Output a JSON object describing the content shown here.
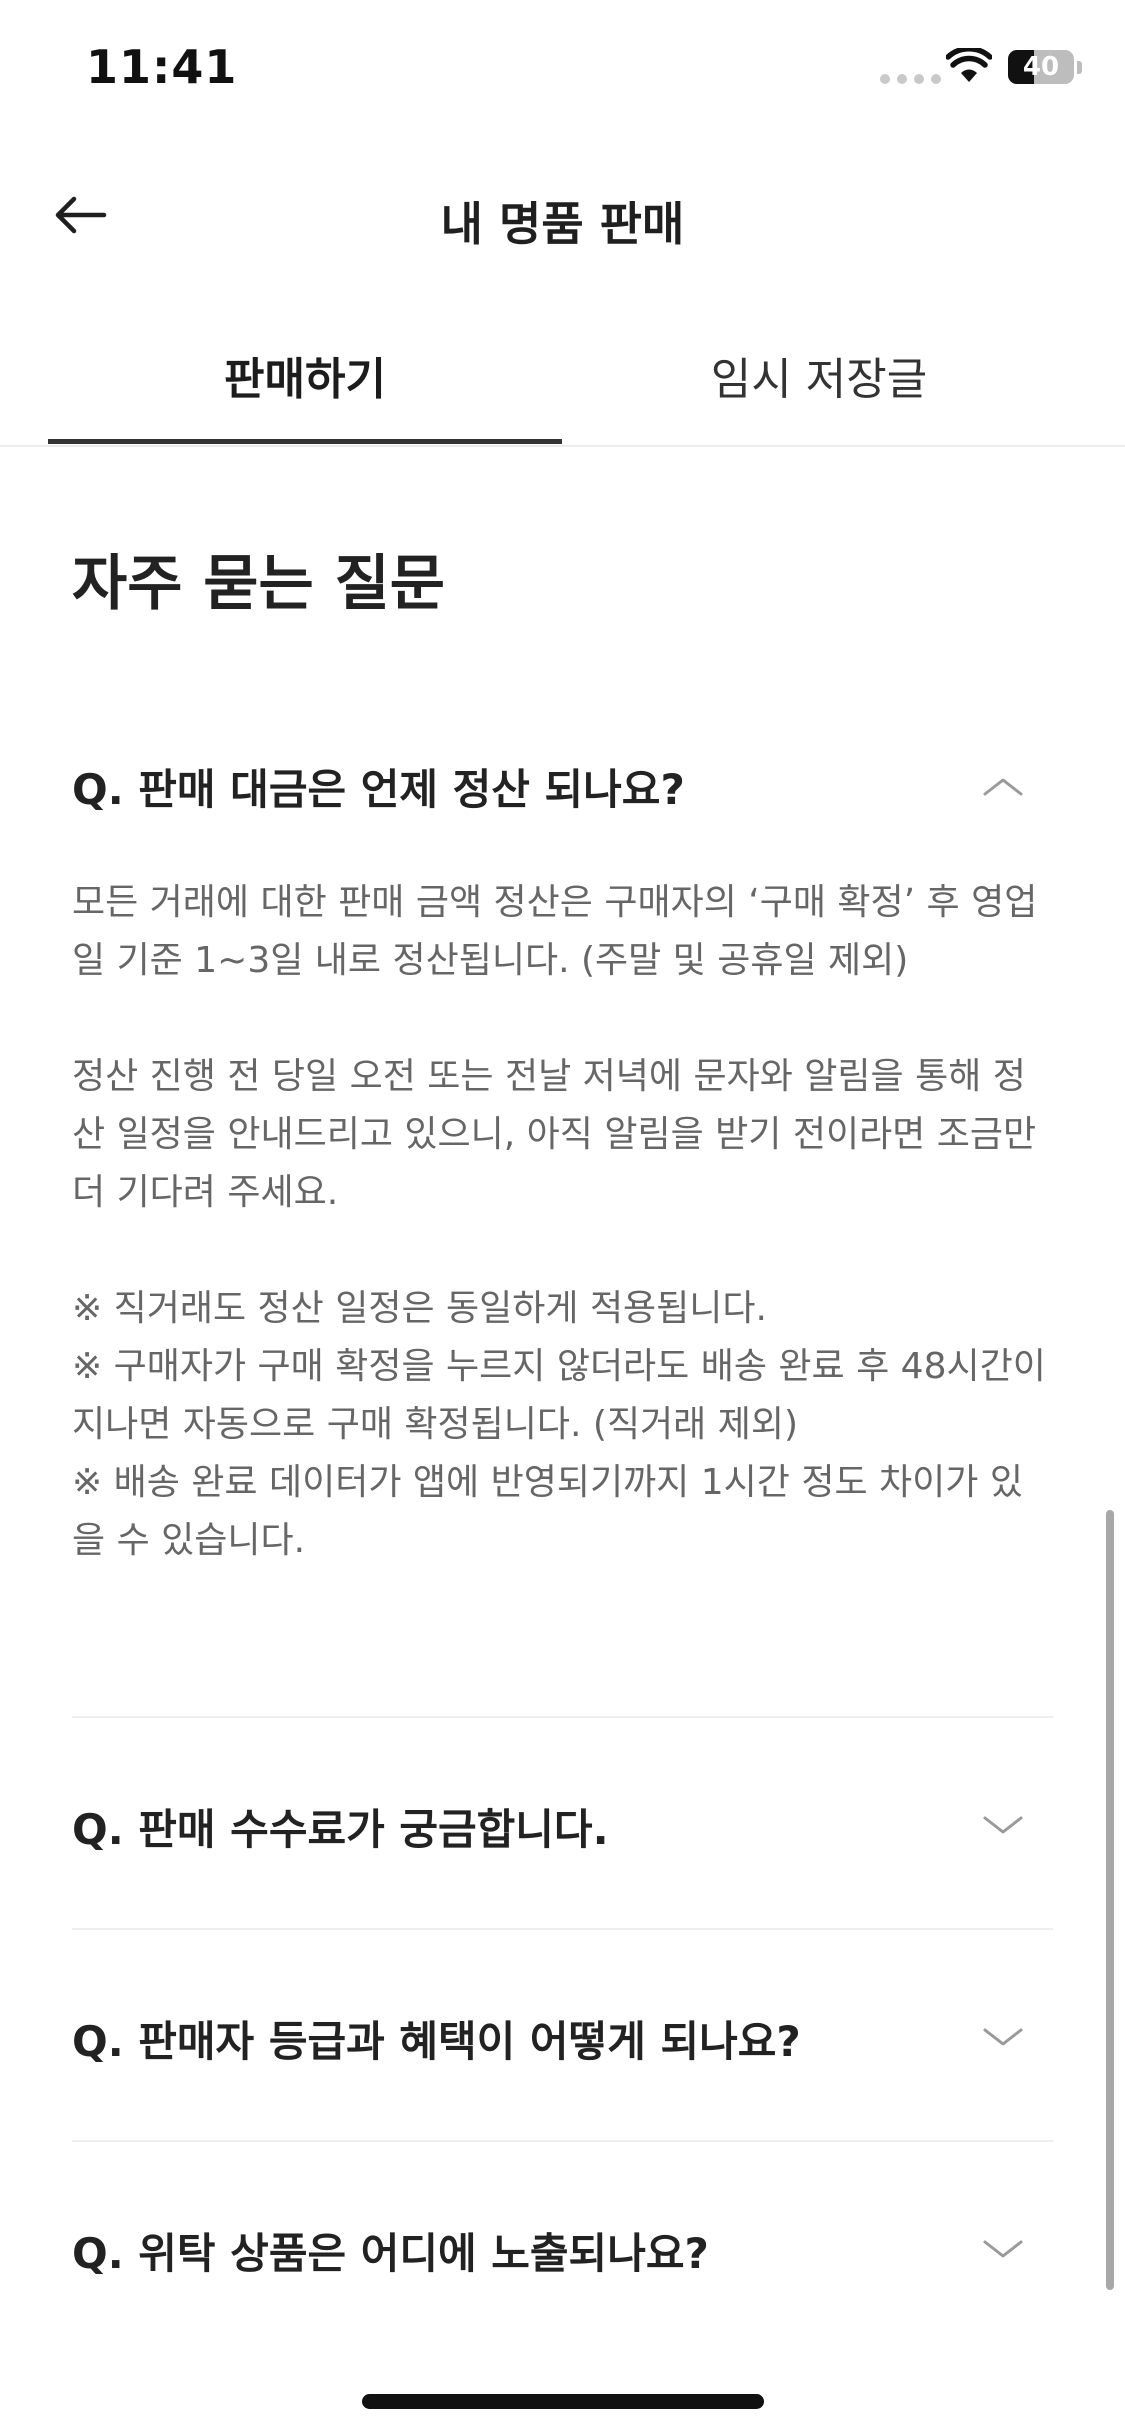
{
  "status_bar": {
    "time": "11:41",
    "battery_level": "40",
    "battery_fraction": 0.4
  },
  "header": {
    "title": "내 명품 판매",
    "back_icon": "arrow-left-icon"
  },
  "tabs": [
    {
      "label": "판매하기",
      "selected": true
    },
    {
      "label": "임시 저장글",
      "selected": false
    }
  ],
  "faq": {
    "heading": "자주 묻는 질문",
    "items": [
      {
        "question": "Q.  판매 대금은 언제 정산 되나요?",
        "expanded": true,
        "chevron_icon": "chevron-up-icon",
        "answer": [
          "모든 거래에 대한 판매 금액 정산은 구매자의 ‘구매 확정’ 후 영업일 기준 1~3일 내로 정산됩니다. (주말 및 공휴일 제외)",
          "정산 진행 전 당일 오전 또는 전날 저녁에 문자와 알림을 통해 정산 일정을 안내드리고 있으니, 아직 알림을 받기 전이라면 조금만 더 기다려 주세요.",
          "※ 직거래도 정산 일정은 동일하게 적용됩니다.\n※ 구매자가 구매 확정을 누르지 않더라도 배송 완료 후 48시간이 지나면 자동으로 구매 확정됩니다. (직거래 제외)\n※ 배송 완료 데이터가 앱에 반영되기까지 1시간 정도 차이가 있을 수 있습니다."
        ]
      },
      {
        "question": "Q.  판매 수수료가 궁금합니다.",
        "expanded": false,
        "chevron_icon": "chevron-down-icon"
      },
      {
        "question": "Q.  판매자 등급과 혜택이 어떻게 되나요?",
        "expanded": false,
        "chevron_icon": "chevron-down-icon"
      },
      {
        "question": "Q.  위탁 상품은 어디에 노출되나요?",
        "expanded": false,
        "chevron_icon": "chevron-down-icon"
      }
    ]
  }
}
